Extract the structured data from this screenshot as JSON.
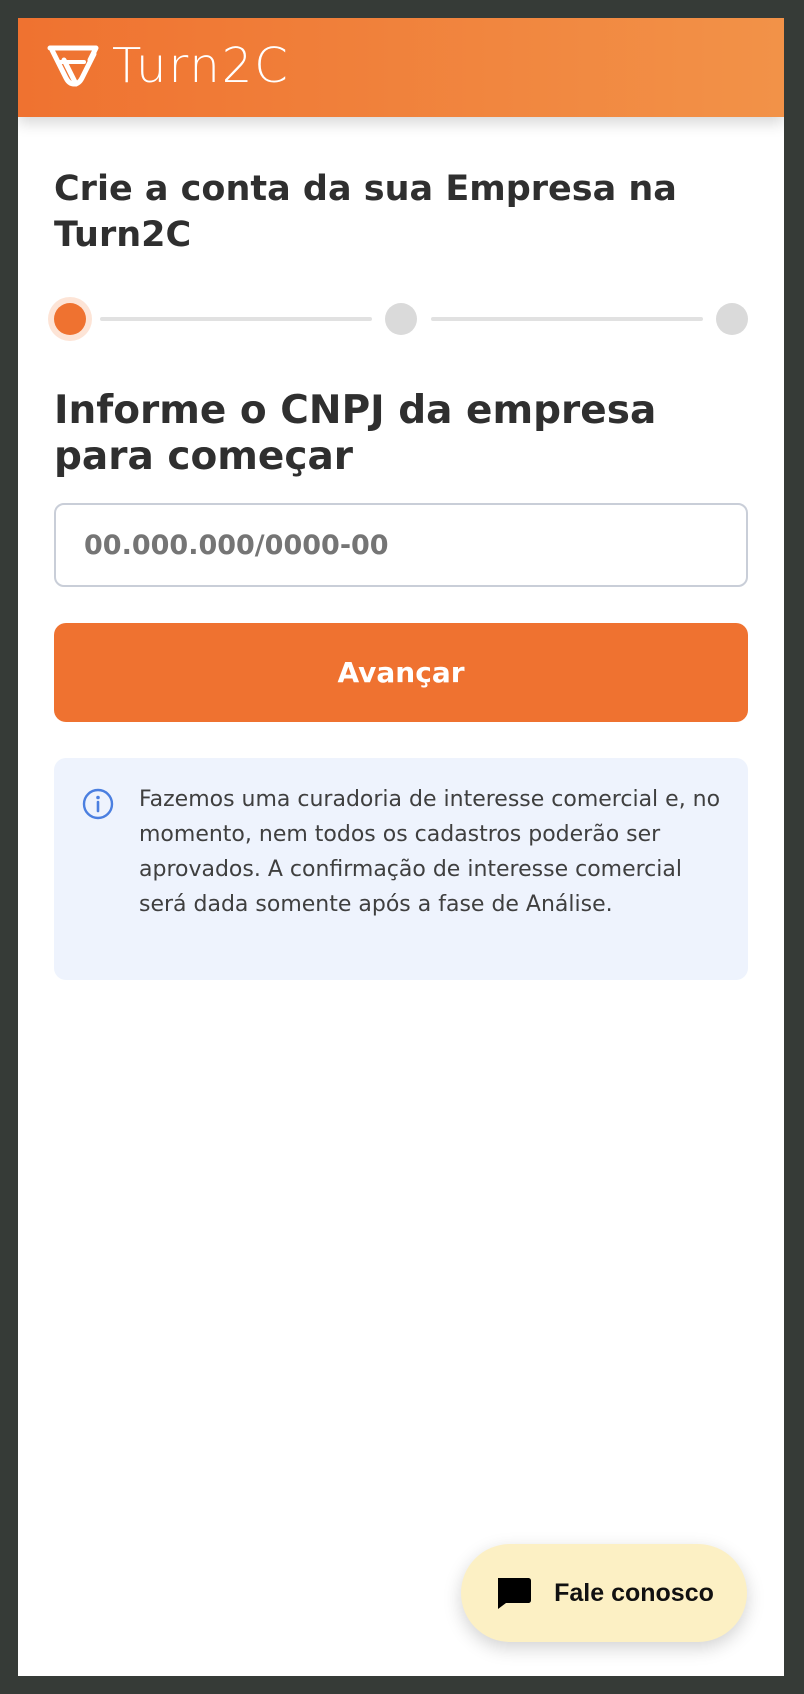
{
  "header": {
    "logo_text": "Turn2C",
    "brand_color": "#ef7230",
    "brand_gradient_end": "#f29248",
    "logo_icon": "turn2c-logo-mark-icon"
  },
  "page": {
    "title": "Crie a conta da sua Empresa na Turn2C"
  },
  "stepper": {
    "total_steps": 3,
    "current_step": 1,
    "active_color": "#ef7230",
    "inactive_color": "#dadada"
  },
  "form": {
    "heading": "Informe o CNPJ da empresa para começar",
    "cnpj_placeholder": "00.000.000/0000-00",
    "cnpj_value": "00.000.000/0000-00",
    "submit_label": "Avançar"
  },
  "info": {
    "icon": "info-circle-icon",
    "text": "Fazemos uma curadoria de interesse comercial e, no momento, nem todos os cadastros poderão ser aprovados. A confirmação de interesse comercial será dada somente após a fase de Análise.",
    "background_color": "#eef3fd",
    "icon_color": "#4b7fe0"
  },
  "chat": {
    "label": "Fale conosco",
    "icon": "chat-bubble-icon",
    "background_color": "#fcf0c4"
  }
}
